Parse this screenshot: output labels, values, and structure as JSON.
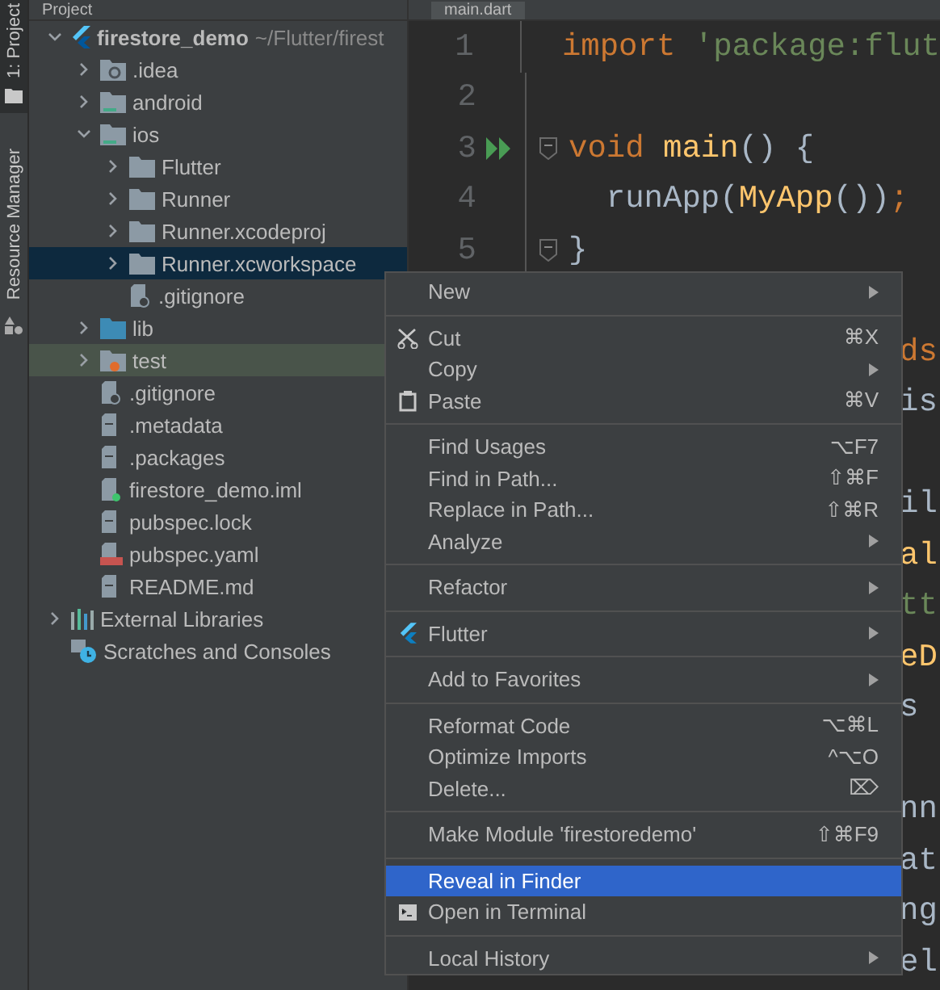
{
  "tool_strip": {
    "project_tab": "1: Project",
    "resource_tab": "Resource Manager"
  },
  "project_panel": {
    "title": "Project",
    "tree": [
      {
        "label": "firestore_demo",
        "hint": "~/Flutter/firest",
        "kind": "flutter",
        "expanded": true,
        "selected": false,
        "children": [
          {
            "label": ".idea",
            "kind": "idea",
            "expanded": false,
            "selected": false
          },
          {
            "label": "android",
            "kind": "module",
            "expanded": false,
            "selected": false
          },
          {
            "label": "ios",
            "kind": "module",
            "expanded": true,
            "selected": false,
            "children": [
              {
                "label": "Flutter",
                "kind": "folder",
                "expanded": false,
                "selected": false
              },
              {
                "label": "Runner",
                "kind": "folder",
                "expanded": false,
                "selected": false
              },
              {
                "label": "Runner.xcodeproj",
                "kind": "folder",
                "expanded": false,
                "selected": false
              },
              {
                "label": "Runner.xcworkspace",
                "kind": "folder",
                "expanded": false,
                "selected": true
              },
              {
                "label": ".gitignore",
                "kind": "ignored",
                "selected": false
              }
            ]
          },
          {
            "label": "lib",
            "kind": "source",
            "expanded": false,
            "selected": false
          },
          {
            "label": "test",
            "kind": "test",
            "expanded": false,
            "selected": false
          },
          {
            "label": ".gitignore",
            "kind": "ignored",
            "selected": false
          },
          {
            "label": ".metadata",
            "kind": "file",
            "selected": false
          },
          {
            "label": ".packages",
            "kind": "file",
            "selected": false
          },
          {
            "label": "firestore_demo.iml",
            "kind": "iml",
            "selected": false
          },
          {
            "label": "pubspec.lock",
            "kind": "file",
            "selected": false
          },
          {
            "label": "pubspec.yaml",
            "kind": "yaml",
            "selected": false
          },
          {
            "label": "README.md",
            "kind": "file",
            "selected": false
          }
        ]
      },
      {
        "label": "External Libraries",
        "kind": "libraries",
        "expanded": false,
        "selected": false
      },
      {
        "label": "Scratches and Consoles",
        "kind": "scratches",
        "selected": false
      }
    ]
  },
  "editor": {
    "tab": "main.dart",
    "lines": [
      {
        "number": "1",
        "tokens": [
          {
            "text": "import ",
            "kind": "keyword"
          },
          {
            "text": "'package:flut",
            "kind": "string"
          }
        ]
      },
      {
        "number": "2"
      },
      {
        "number": "3",
        "run": true,
        "fold": true,
        "tokens": [
          {
            "text": "void ",
            "kind": "keyword"
          },
          {
            "text": "main",
            "kind": "function"
          },
          {
            "text": "() {",
            "kind": "plain"
          }
        ]
      },
      {
        "number": "4",
        "tokens": [
          {
            "text": "  runApp(",
            "kind": "plain"
          },
          {
            "text": "MyApp",
            "kind": "function"
          },
          {
            "text": "())",
            "kind": "plain"
          },
          {
            "text": ";",
            "kind": "keyword"
          }
        ]
      },
      {
        "number": "5",
        "fold": true,
        "tokens": [
          {
            "text": "}",
            "kind": "plain"
          }
        ]
      }
    ],
    "covered_blocks": [
      [
        {
          "text": "ds",
          "kind": "keyword"
        },
        {
          "text": "is",
          "kind": "plain"
        }
      ],
      [
        {
          "text": "il",
          "kind": "plain"
        },
        {
          "text": "al",
          "kind": "function"
        },
        {
          "text": "tt",
          "kind": "string"
        },
        {
          "text": "eD",
          "kind": "function"
        },
        {
          "text": "s",
          "kind": "plain"
        }
      ],
      [
        {
          "text": "nn",
          "kind": "plain"
        },
        {
          "text": "at",
          "kind": "plain"
        },
        {
          "text": "ng",
          "kind": "plain"
        },
        {
          "text": "el",
          "kind": "plain"
        }
      ]
    ]
  },
  "context_menu": [
    {
      "kind": "plain",
      "label": "New",
      "submenu": true,
      "selected": false
    },
    {
      "kind": "separator"
    },
    {
      "kind": "cut",
      "label": "Cut",
      "shortcut": "⌘X",
      "selected": false
    },
    {
      "kind": "plain",
      "label": "Copy",
      "submenu": true,
      "selected": false
    },
    {
      "kind": "paste",
      "label": "Paste",
      "shortcut": "⌘V",
      "selected": false
    },
    {
      "kind": "separator"
    },
    {
      "kind": "plain",
      "label": "Find Usages",
      "shortcut": "⌥F7",
      "selected": false
    },
    {
      "kind": "plain",
      "label": "Find in Path...",
      "shortcut": "⇧⌘F",
      "selected": false
    },
    {
      "kind": "plain",
      "label": "Replace in Path...",
      "shortcut": "⇧⌘R",
      "selected": false
    },
    {
      "kind": "plain",
      "label": "Analyze",
      "submenu": true,
      "selected": false
    },
    {
      "kind": "separator"
    },
    {
      "kind": "plain",
      "label": "Refactor",
      "submenu": true,
      "selected": false
    },
    {
      "kind": "separator"
    },
    {
      "kind": "flutter",
      "label": "Flutter",
      "submenu": true,
      "selected": false
    },
    {
      "kind": "separator"
    },
    {
      "kind": "plain",
      "label": "Add to Favorites",
      "submenu": true,
      "selected": false
    },
    {
      "kind": "separator"
    },
    {
      "kind": "plain",
      "label": "Reformat Code",
      "shortcut": "⌥⌘L",
      "selected": false
    },
    {
      "kind": "plain",
      "label": "Optimize Imports",
      "shortcut": "^⌥O",
      "selected": false
    },
    {
      "kind": "plain",
      "label": "Delete...",
      "shortcut": "⌦",
      "selected": false
    },
    {
      "kind": "separator"
    },
    {
      "kind": "plain",
      "label": "Make Module 'firestoredemo'",
      "shortcut": "⇧⌘F9",
      "selected": false
    },
    {
      "kind": "separator"
    },
    {
      "kind": "plain",
      "label": "Reveal in Finder",
      "selected": true
    },
    {
      "kind": "terminal",
      "label": "Open in Terminal",
      "selected": false
    },
    {
      "kind": "separator"
    },
    {
      "kind": "plain",
      "label": "Local History",
      "submenu": true,
      "selected": false
    }
  ]
}
